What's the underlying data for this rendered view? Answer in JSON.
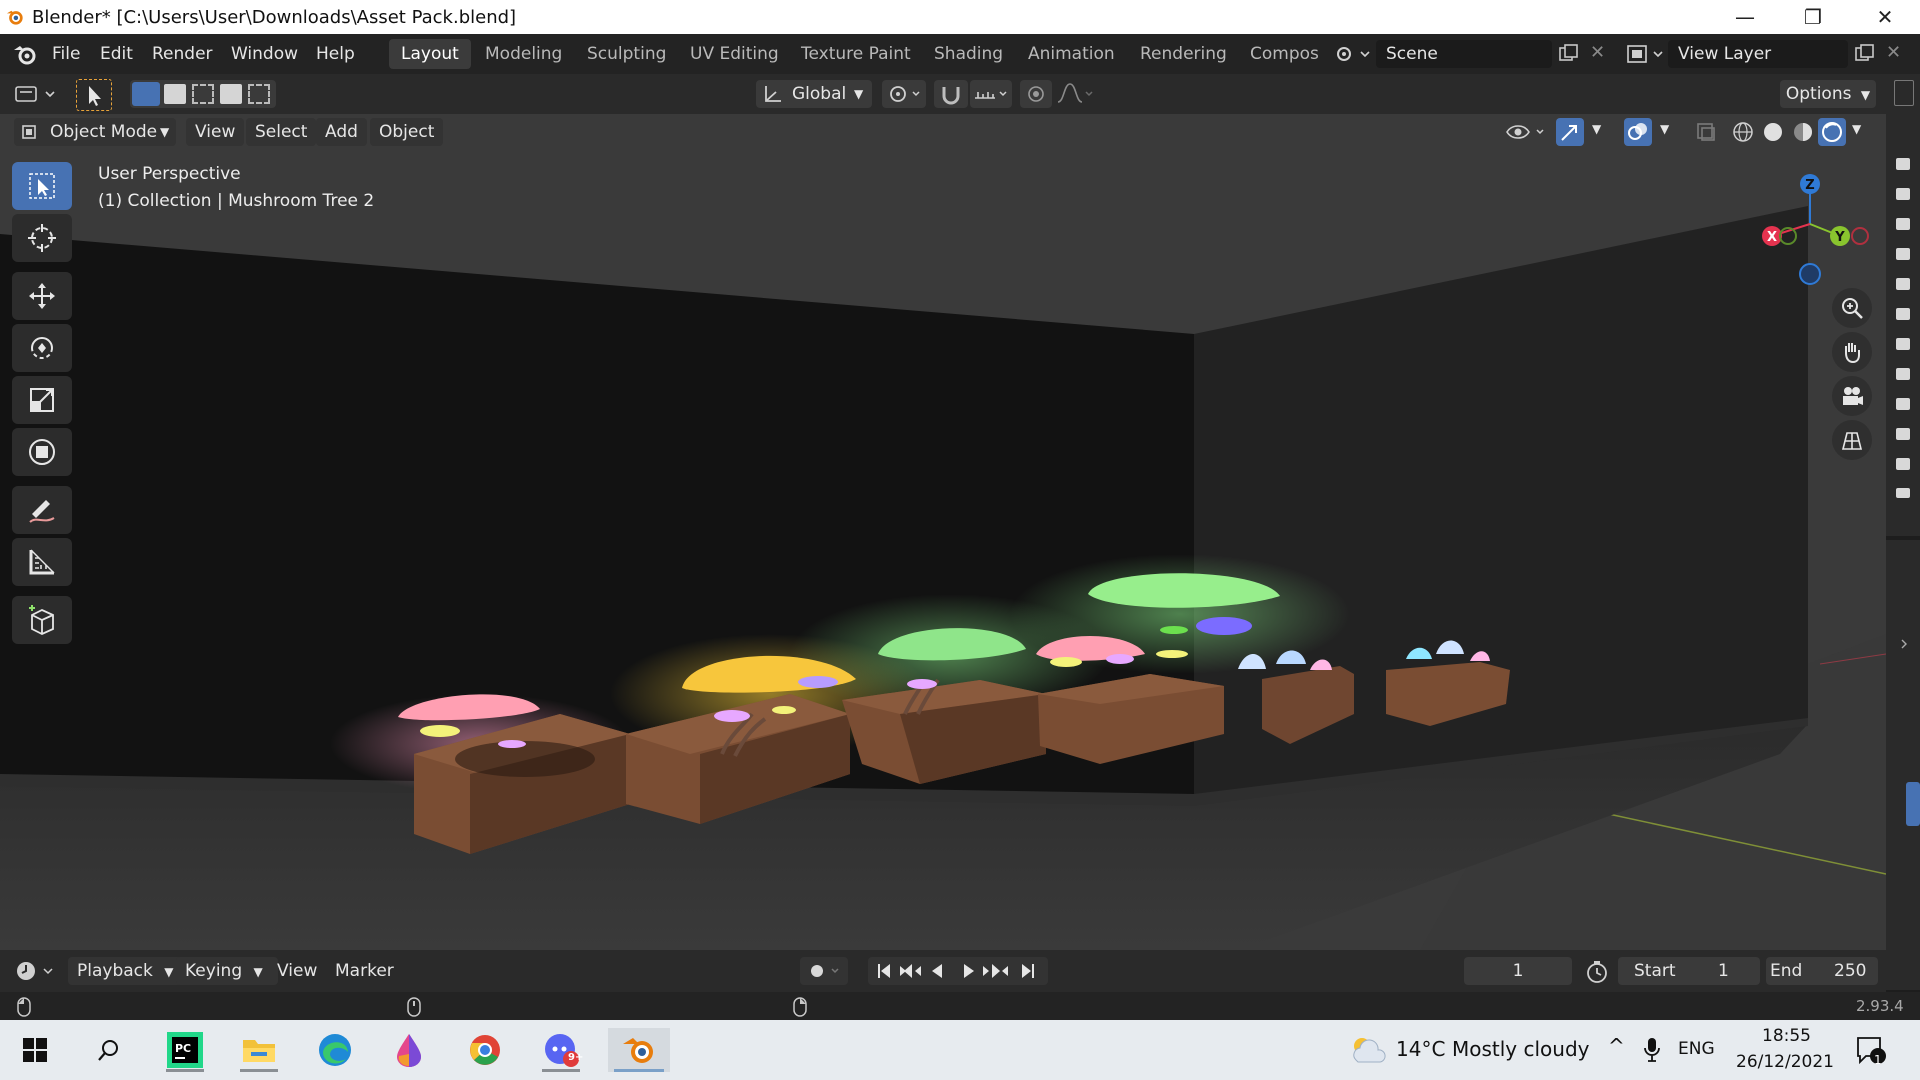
{
  "window": {
    "title": "Blender* [C:\\Users\\User\\Downloads\\Asset Pack.blend]",
    "min_glyph": "—",
    "restore_glyph": "❐",
    "close_glyph": "✕"
  },
  "menu": [
    "File",
    "Edit",
    "Render",
    "Window",
    "Help"
  ],
  "workspaces": [
    "Layout",
    "Modeling",
    "Sculpting",
    "UV Editing",
    "Texture Paint",
    "Shading",
    "Animation",
    "Rendering",
    "Compos"
  ],
  "scene": {
    "label": "Scene"
  },
  "view_layer": {
    "label": "View Layer"
  },
  "header": {
    "orientation": "Global",
    "options": "Options",
    "mode": "Object Mode",
    "menus": [
      "View",
      "Select",
      "Add",
      "Object"
    ]
  },
  "viewport": {
    "perspective": "User Perspective",
    "collection": "(1) Collection | Mushroom Tree 2",
    "gizmo": {
      "x": "X",
      "y": "Y",
      "z": "Z"
    }
  },
  "timeline": {
    "menus": [
      "Playback",
      "Keying",
      "View",
      "Marker"
    ],
    "current_frame": "1",
    "start_label": "Start",
    "start_value": "1",
    "end_label": "End",
    "end_value": "250"
  },
  "status": {
    "version": "2.93.4"
  },
  "taskbar": {
    "temperature": "14°C",
    "weather": "Mostly cloudy",
    "lang": "ENG",
    "time": "18:55",
    "date": "26/12/2021",
    "notif_count": "1",
    "app_badge": "9+"
  },
  "colors": {
    "accent": "#4772b3",
    "axis_x": "#e5334f",
    "axis_y": "#89c42e",
    "axis_z": "#2f7ad6"
  }
}
